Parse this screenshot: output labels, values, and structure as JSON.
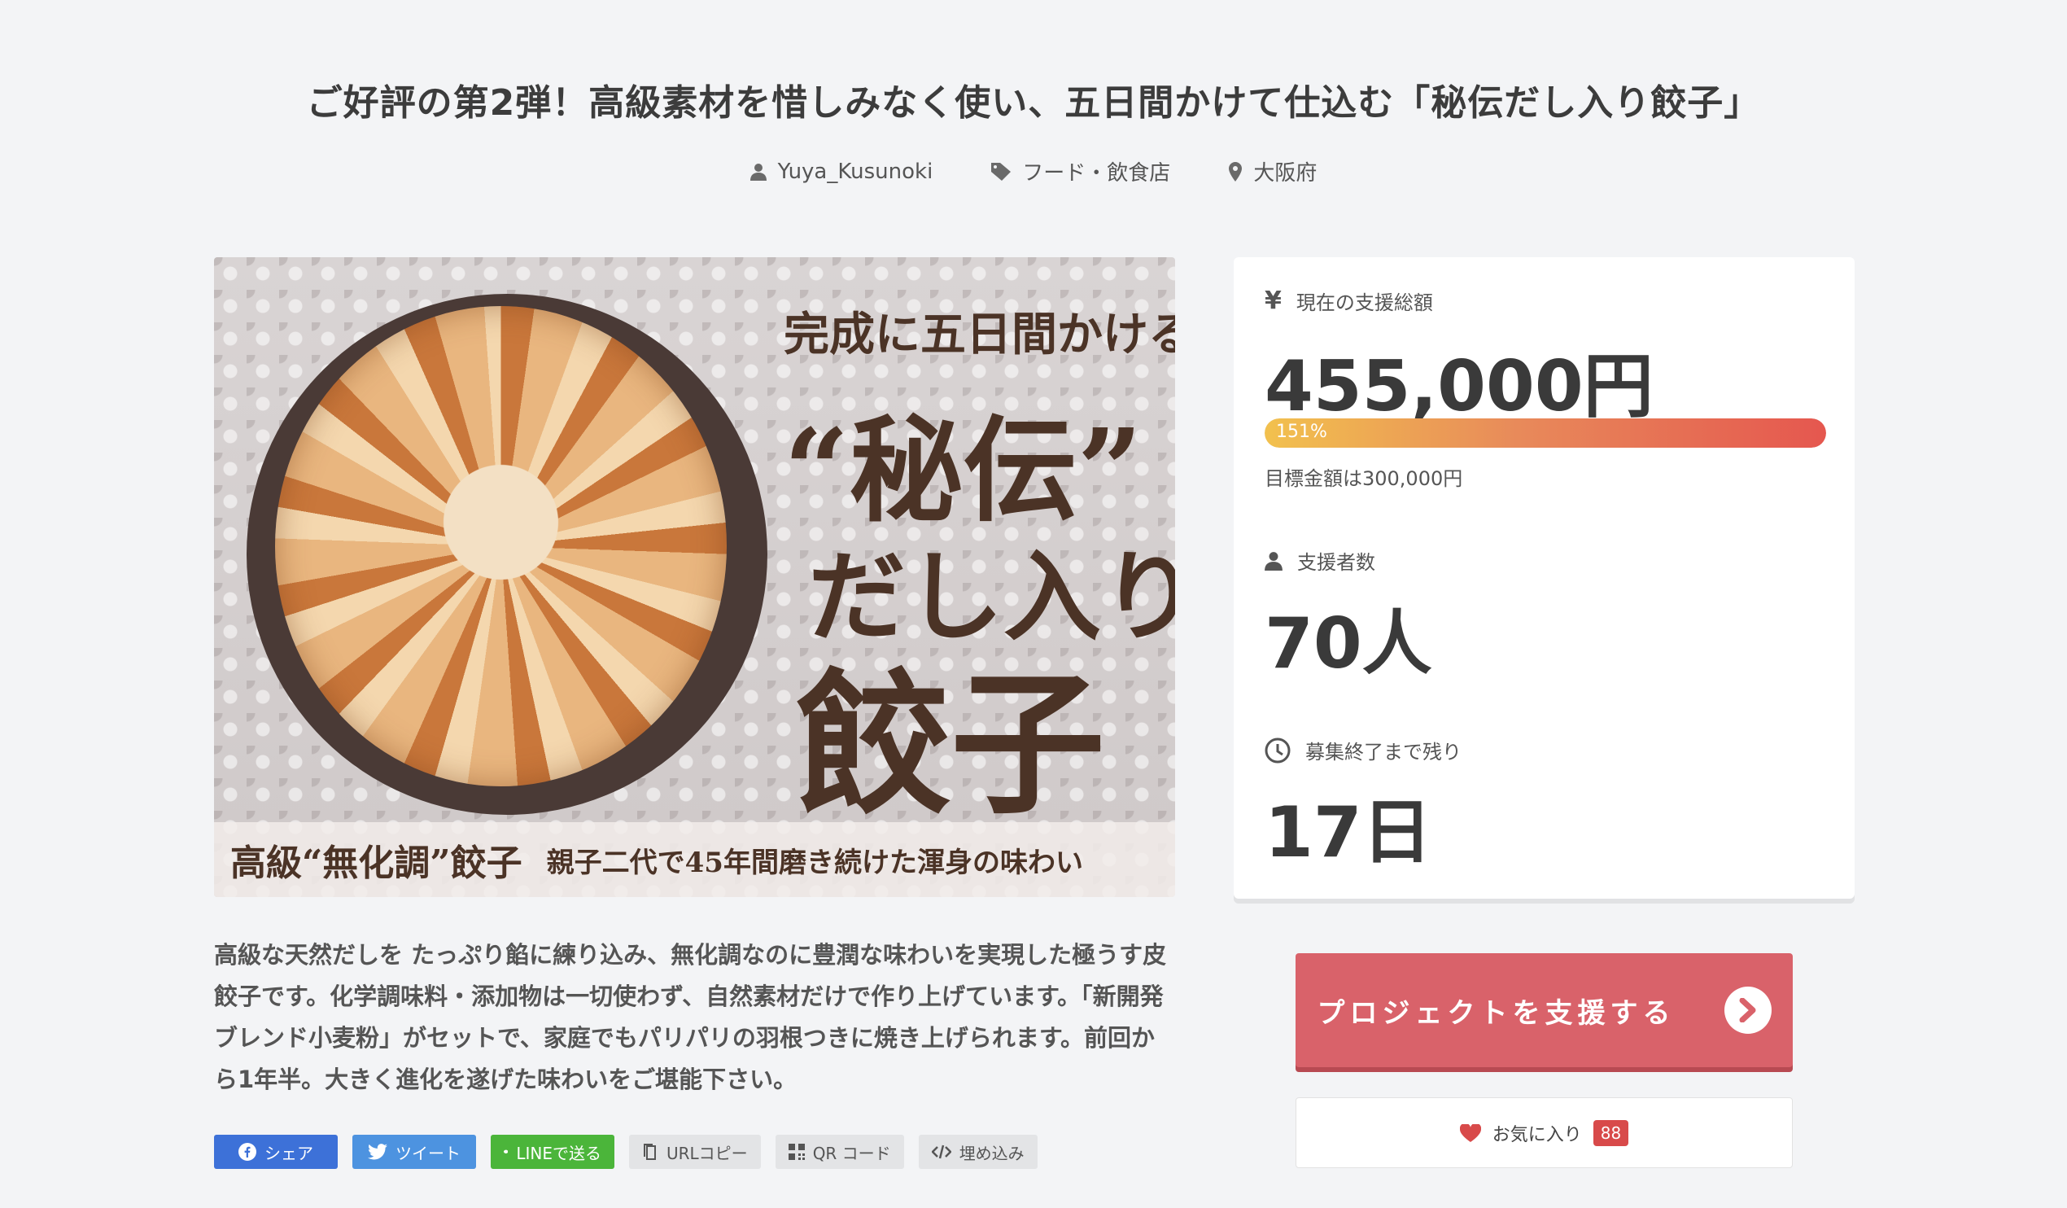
{
  "project": {
    "title": "ご好評の第2弾！高級素材を惜しみなく使い、五日間かけて仕込む「秘伝だし入り餃子」",
    "author": "Yuya_Kusunoki",
    "category": "フード・飲食店",
    "location": "大阪府"
  },
  "hero": {
    "line1": "完成に五日間かける、",
    "line2": "“秘伝”",
    "line3": "だし入り",
    "line4": "餃子",
    "band_main": "高級“無化調”餃子",
    "band_sub": "親子二代で45年間磨き続けた渾身の味わい"
  },
  "description": "高級な天然だしを たっぷり餡に練り込み、無化調なのに豊潤な味わいを実現した極うす皮餃子です。化学調味料・添加物は一切使わず、自然素材だけで作り上げています。「新開発ブレンド小麦粉」がセットで、家庭でもパリパリの羽根つきに焼き上げられます。前回から1年半。大きく進化を遂げた味わいをご堪能下さい。",
  "share": {
    "facebook": "シェア",
    "twitter": "ツイート",
    "line": "LINEで送る",
    "url_copy": "URLコピー",
    "qr": "QR コード",
    "embed": "埋め込み"
  },
  "stats": {
    "amount_label": "現在の支援総額",
    "amount_value": "455,000円",
    "progress_text": "151%",
    "progress_percent": 151,
    "goal_text": "目標金額は300,000円",
    "backers_label": "支援者数",
    "backers_value": "70人",
    "remaining_label": "募集終了まで残り",
    "remaining_value": "17日"
  },
  "actions": {
    "support_label": "プロジェクトを支援する",
    "favorite_label": "お気に入り",
    "favorite_count": "88"
  },
  "colors": {
    "support_button": "#d9626a",
    "badge": "#d84a4a",
    "facebook": "#3d71d8",
    "twitter": "#4d93e0",
    "line": "#4bb53a"
  },
  "icons": {
    "author": "user-icon",
    "category": "tag-icon",
    "location": "map-pin-icon",
    "amount": "yen-icon",
    "backers": "user-icon",
    "remaining": "clock-icon",
    "support_arrow": "chevron-right-icon",
    "favorite": "heart-icon"
  }
}
